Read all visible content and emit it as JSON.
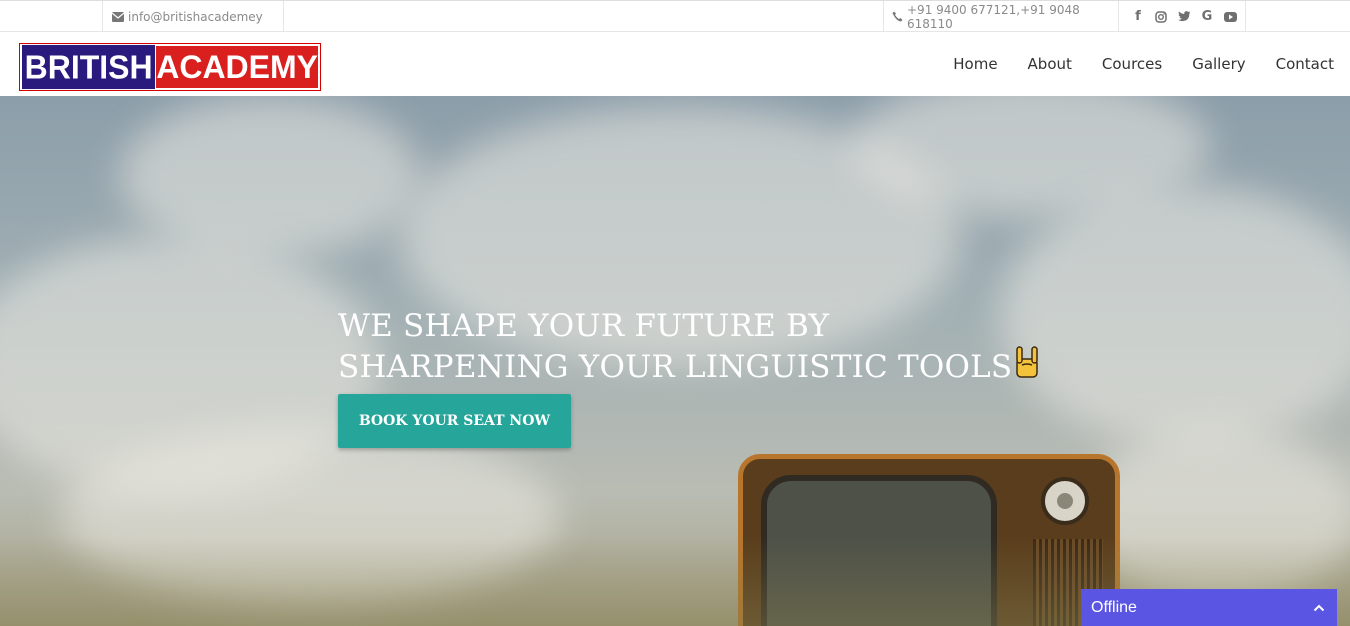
{
  "topbar": {
    "email": "info@britishacademey",
    "phone": "+91 9400 677121,+91 9048 618110",
    "social": [
      {
        "icon": "facebook-icon",
        "glyph": "f"
      },
      {
        "icon": "instagram-icon",
        "glyph": ""
      },
      {
        "icon": "twitter-icon",
        "glyph": ""
      },
      {
        "icon": "google-icon",
        "glyph": "G"
      },
      {
        "icon": "youtube-icon",
        "glyph": ""
      }
    ]
  },
  "logo": {
    "part1": "BRITISH",
    "part2": "ACADEMY",
    "colors": {
      "part1_bg": "#2a1a7e",
      "part2_bg": "#da1f1f"
    }
  },
  "nav": {
    "items": [
      "Home",
      "About",
      "Cources",
      "Gallery",
      "Contact"
    ]
  },
  "hero": {
    "headline_line1": "WE SHAPE YOUR FUTURE BY",
    "headline_line2": "SHARPENING YOUR LINGUISTIC TOOLS",
    "emoji_icon": "rock-hand-icon",
    "cta_label": "BOOK YOUR SEAT NOW",
    "cta_color": "#26a69a"
  },
  "chat": {
    "status": "Offline",
    "color": "#5b55e3",
    "toggle_icon": "chevron-up-icon"
  }
}
